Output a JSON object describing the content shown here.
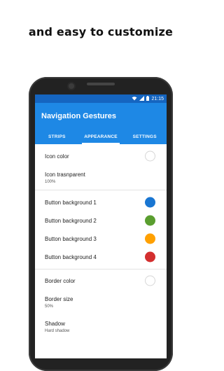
{
  "headline": "and easy to customize",
  "status": {
    "time": "21:15",
    "wifi_icon": "wifi-icon",
    "signal_icon": "signal-icon",
    "battery_icon": "battery-icon"
  },
  "app": {
    "title": "Navigation Gestures"
  },
  "tabs": [
    {
      "label": "STRIPS",
      "active": false
    },
    {
      "label": "APPEARANCE",
      "active": true
    },
    {
      "label": "SETTINGS",
      "active": false
    }
  ],
  "settings": {
    "icon_color": {
      "label": "Icon color",
      "color": "#ffffff"
    },
    "icon_transparent": {
      "label": "Icon trasnparent",
      "value": "100%"
    },
    "button_bg_1": {
      "label": "Button background 1",
      "color": "#1976d2"
    },
    "button_bg_2": {
      "label": "Button background 2",
      "color": "#5a9e2f"
    },
    "button_bg_3": {
      "label": "Button background 3",
      "color": "#ffa000"
    },
    "button_bg_4": {
      "label": "Button background 4",
      "color": "#d32f2f"
    },
    "border_color": {
      "label": "Border color",
      "color": "#ffffff"
    },
    "border_size": {
      "label": "Border size",
      "value": "50%"
    },
    "shadow": {
      "label": "Shadow",
      "value": "Hard shadow"
    }
  }
}
